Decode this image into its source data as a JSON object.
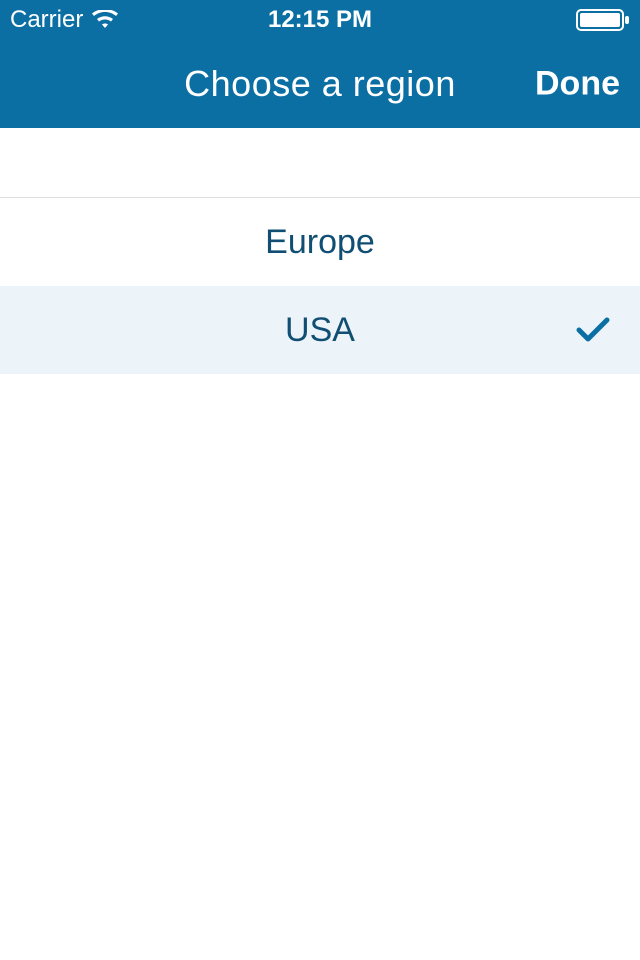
{
  "status_bar": {
    "carrier": "Carrier",
    "time": "12:15 PM"
  },
  "nav": {
    "title": "Choose a region",
    "done_label": "Done"
  },
  "list": {
    "items": [
      {
        "label": "Europe",
        "selected": false
      },
      {
        "label": "USA",
        "selected": true
      }
    ]
  },
  "colors": {
    "brand": "#0b6fa4",
    "text_primary": "#104f73",
    "selected_bg": "#ecf3f9"
  }
}
